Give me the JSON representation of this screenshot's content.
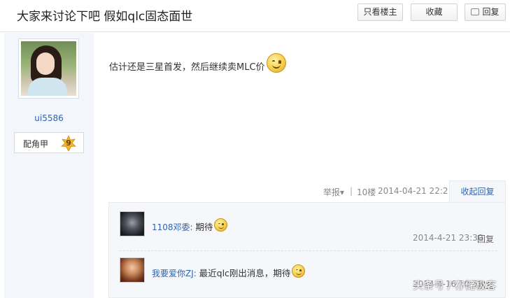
{
  "thread": {
    "title": "大家来讨论下吧 假如qlc固态面世"
  },
  "toolbar": {
    "only_op": "只看楼主",
    "favorite": "收藏",
    "reply": "回复"
  },
  "author": {
    "username": "ui5586",
    "badge_label": "配角甲",
    "level": "9"
  },
  "post": {
    "content": "估计还是三星首发，然后继续卖MLC价"
  },
  "post_meta": {
    "report": "举报▾",
    "separator": "|",
    "floor": "10楼",
    "time": "2014-04-21 22:21",
    "collapse_reply": "收起回复"
  },
  "replies": [
    {
      "user": "1108邓委:",
      "text": "期待",
      "time": "2014-4-21 23:30",
      "reply": "回复"
    },
    {
      "user": "我要爱你ZJ:",
      "text": "最近qlc刚出消息，期待",
      "time": "2014-4-16 10:58",
      "reply": "回复"
    }
  ],
  "watermark": "头条号 / 存储极客",
  "icons": [
    "smiley-emoji-icon",
    "reply-icon",
    "level-star-icon"
  ],
  "colors": {
    "link": "#2d64b3",
    "sidebar_bg": "#f3f6fa",
    "badge_star": "#f3b62b"
  }
}
